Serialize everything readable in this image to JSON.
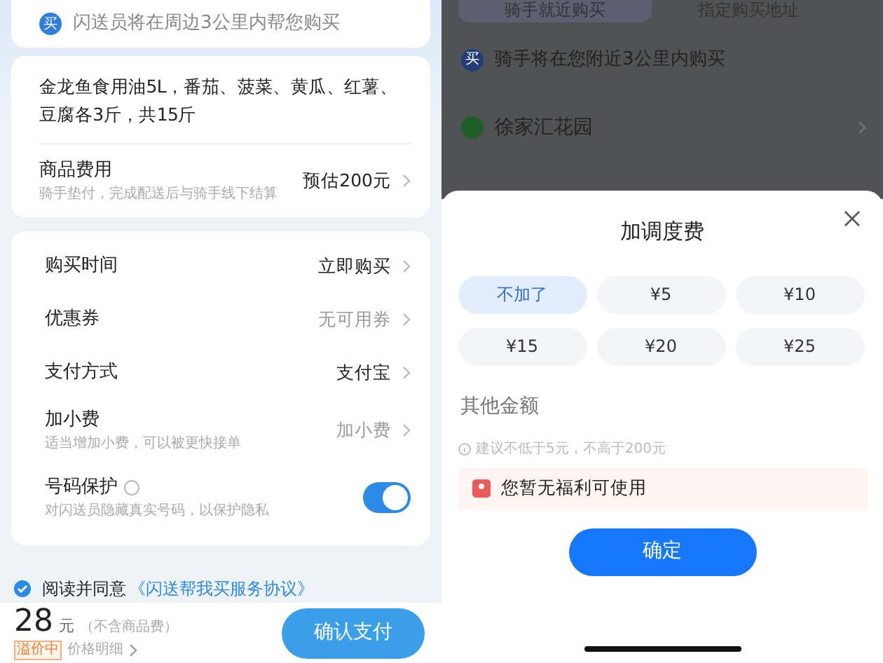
{
  "left": {
    "notice": {
      "icon_text": "买",
      "text": "闪送员将在周边3公里内帮您购买"
    },
    "order": {
      "description": "金龙鱼食用油5L，番茄、菠菜、黄瓜、红薯、豆腐各3斤，共15斤",
      "fee": {
        "label": "商品费用",
        "hint": "骑手垫付，完成配送后与骑手线下结算",
        "value": "预估200元"
      }
    },
    "settings": [
      {
        "kind": "link",
        "label": "购买时间",
        "value": "立即购买",
        "muted": false
      },
      {
        "kind": "link",
        "label": "优惠券",
        "value": "无可用券",
        "muted": true
      },
      {
        "kind": "link",
        "label": "支付方式",
        "value": "支付宝",
        "muted": false
      },
      {
        "kind": "link",
        "label": "加小费",
        "hint": "适当增加小费，可以被更快接单",
        "value": "加小费",
        "muted": true
      },
      {
        "kind": "toggle",
        "label": "号码保护",
        "hint": "对闪送员隐藏真实号码，以保护隐私",
        "on": true
      }
    ],
    "agreement": {
      "checked": true,
      "text": "阅读并同意",
      "link": "《闪送帮我买服务协议》"
    },
    "footer": {
      "price": "28",
      "unit": "元",
      "note": "（不含商品费）",
      "tag": "溢价中",
      "details": "价格明细",
      "button": "确认支付"
    }
  },
  "right": {
    "background": {
      "tabs": [
        {
          "label": "骑手就近购买",
          "selected": true
        },
        {
          "label": "指定购买地址",
          "selected": false
        }
      ],
      "notice": {
        "icon_text": "买",
        "text": "骑手将在您附近3公里内购买"
      },
      "address": {
        "name": "徐家汇花园"
      }
    },
    "sheet": {
      "title": "加调度费",
      "options": [
        {
          "label": "不加了",
          "selected": true
        },
        {
          "label": "¥5",
          "selected": false
        },
        {
          "label": "¥10",
          "selected": false
        },
        {
          "label": "¥15",
          "selected": false
        },
        {
          "label": "¥20",
          "selected": false
        },
        {
          "label": "¥25",
          "selected": false
        }
      ],
      "amount_placeholder": "其他金额",
      "hint": "建议不低于5元，不高于200元",
      "benefit": "您暂无福利可使用",
      "confirm": "确定"
    }
  }
}
